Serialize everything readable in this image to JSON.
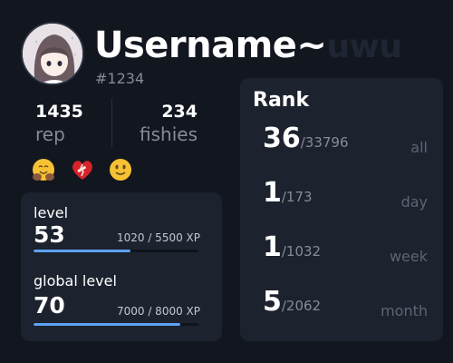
{
  "profile": {
    "username": "Username~",
    "username_suffix": "uwu",
    "discriminator": "#1234"
  },
  "stats": {
    "rep": {
      "value": "1435",
      "label": "rep"
    },
    "fishies": {
      "value": "234",
      "label": "fishies"
    }
  },
  "badges": [
    {
      "icon": "hugging-face-emoji-icon"
    },
    {
      "icon": "mending-heart-emoji-icon"
    },
    {
      "icon": "slightly-smiling-face-emoji-icon"
    }
  ],
  "levels": {
    "level": {
      "label": "level",
      "value": "53",
      "xp": "1020 / 5500 XP",
      "progress": 0.59
    },
    "global_level": {
      "label": "global level",
      "value": "70",
      "xp": "7000 / 8000 XP",
      "progress": 0.89
    }
  },
  "rank": {
    "title": "Rank",
    "rows": [
      {
        "position": "36",
        "total": "/33796",
        "period": "all"
      },
      {
        "position": "1",
        "total": "/173",
        "period": "day"
      },
      {
        "position": "1",
        "total": "/1032",
        "period": "week"
      },
      {
        "position": "5",
        "total": "/2062",
        "period": "month"
      }
    ]
  },
  "colors": {
    "background": "#12161f",
    "card": "#1c222e",
    "accent": "#5ea2f2",
    "muted_text": "#858b99"
  }
}
